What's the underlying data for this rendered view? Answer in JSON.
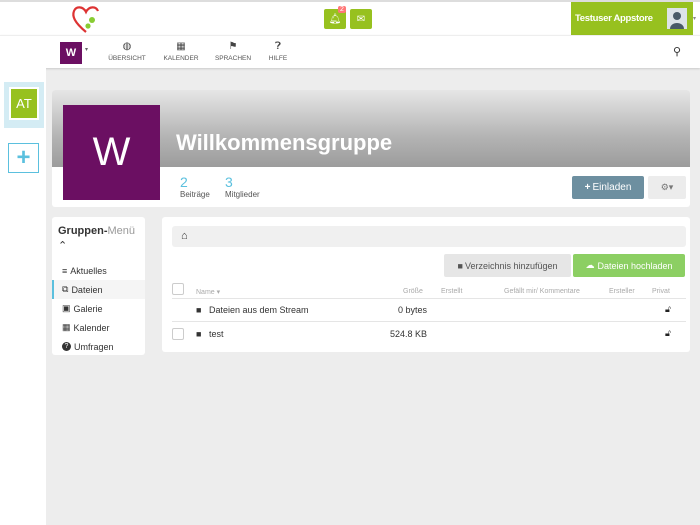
{
  "header": {
    "notification_count": "2",
    "user_name": "Testuser Appstore"
  },
  "nav": {
    "space_initial": "W",
    "items": [
      {
        "label": "ÜBERSICHT"
      },
      {
        "label": "KALENDER"
      },
      {
        "label": "SPRACHEN"
      },
      {
        "label": "HILFE"
      }
    ]
  },
  "sidebar": {
    "space_initials": "AT",
    "add": "+"
  },
  "group": {
    "initial": "W",
    "title": "Willkommensgruppe",
    "stats": [
      {
        "value": "2",
        "label": "Beiträge"
      },
      {
        "value": "3",
        "label": "Mitglieder"
      }
    ],
    "invite_label": "Einladen",
    "invite_icon": "+",
    "gear_icon": "⚙▾"
  },
  "menu": {
    "title_bold": "Gruppen-",
    "title_rest": "Menü",
    "items": [
      {
        "label": "Aktuelles",
        "icon": "≡"
      },
      {
        "label": "Dateien",
        "icon": "⧉"
      },
      {
        "label": "Galerie",
        "icon": "▣"
      },
      {
        "label": "Kalender",
        "icon": "▦"
      },
      {
        "label": "Umfragen",
        "icon": "?"
      }
    ]
  },
  "files": {
    "add_dir": "Verzeichnis hinzufügen",
    "upload": "Dateien hochladen",
    "columns": {
      "name": "Name ▾",
      "size": "Größe",
      "created": "Erstellt",
      "likes": "Gefällt mir/ Kommentare",
      "creator": "Ersteller",
      "private": "Privat"
    },
    "rows": [
      {
        "name": "Dateien aus dem Stream",
        "size": "0 bytes"
      },
      {
        "name": "test",
        "size": "524.8 KB"
      }
    ]
  },
  "colors": {
    "green": "#97c11f",
    "purple": "#6b0f62",
    "upload": "#8ccf63",
    "invite": "#6d8fa0",
    "accent": "#5bc0de"
  }
}
